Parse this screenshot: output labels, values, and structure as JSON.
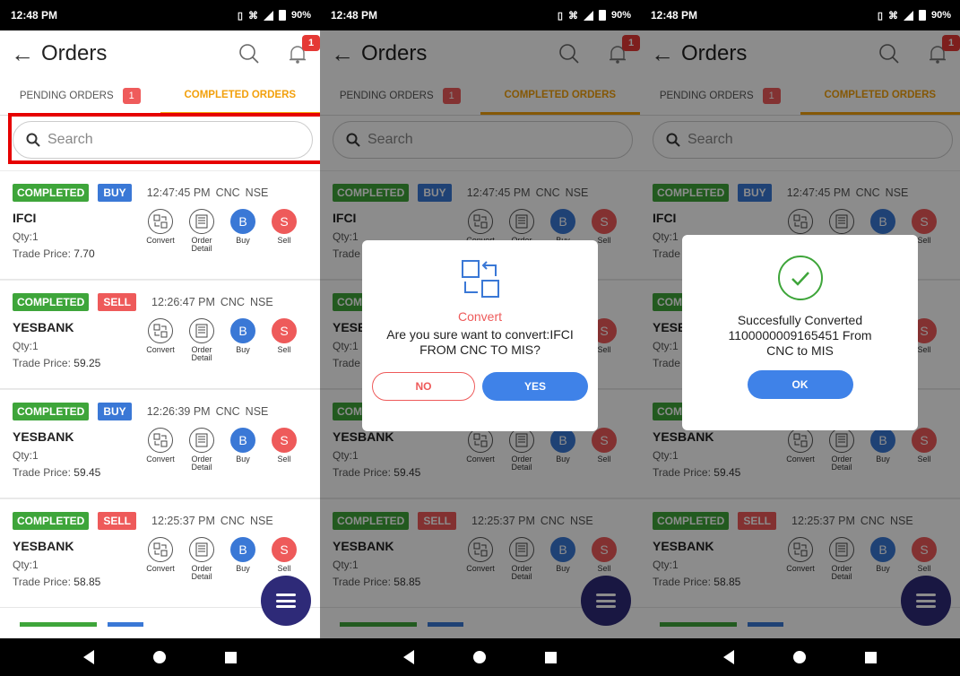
{
  "status_bar": {
    "time": "12:48 PM",
    "battery": "90%"
  },
  "header": {
    "title": "Orders",
    "notification_count": "1"
  },
  "tabs": {
    "pending": {
      "label": "PENDING ORDERS",
      "badge": "1"
    },
    "completed": {
      "label": "COMPLETED ORDERS"
    }
  },
  "search": {
    "placeholder": "Search"
  },
  "actions": {
    "convert": "Convert",
    "order_detail": "Order Detail",
    "buy": "Buy",
    "sell": "Sell",
    "buy_icon": "B",
    "sell_icon": "S"
  },
  "orders": [
    {
      "status": "COMPLETED",
      "side": "BUY",
      "time": "12:47:45 PM",
      "product": "CNC",
      "exchange": "NSE",
      "symbol": "IFCI",
      "qty": "Qty:1",
      "price_label": "Trade Price:",
      "price": "7.70"
    },
    {
      "status": "COMPLETED",
      "side": "SELL",
      "time": "12:26:47 PM",
      "product": "CNC",
      "exchange": "NSE",
      "symbol": "YESBANK",
      "qty": "Qty:1",
      "price_label": "Trade Price:",
      "price": "59.25"
    },
    {
      "status": "COMPLETED",
      "side": "BUY",
      "time": "12:26:39 PM",
      "product": "CNC",
      "exchange": "NSE",
      "symbol": "YESBANK",
      "qty": "Qty:1",
      "price_label": "Trade Price:",
      "price": "59.45"
    },
    {
      "status": "COMPLETED",
      "side": "SELL",
      "time": "12:25:37 PM",
      "product": "CNC",
      "exchange": "NSE",
      "symbol": "YESBANK",
      "qty": "Qty:1",
      "price_label": "Trade Price:",
      "price": "58.85"
    }
  ],
  "confirm_dialog": {
    "title": "Convert",
    "message": "Are you sure want to convert:IFCI FROM CNC TO MIS?",
    "no_label": "NO",
    "yes_label": "YES"
  },
  "success_dialog": {
    "message": "Succesfully Converted 1100000009165451 From CNC to MIS",
    "ok_label": "OK"
  },
  "colors": {
    "accent": "#f2a00c",
    "completed": "#3ea53a",
    "buy": "#3a78d6",
    "sell": "#ee5a5a",
    "fab": "#2e2a78",
    "highlight": "#e60000"
  }
}
